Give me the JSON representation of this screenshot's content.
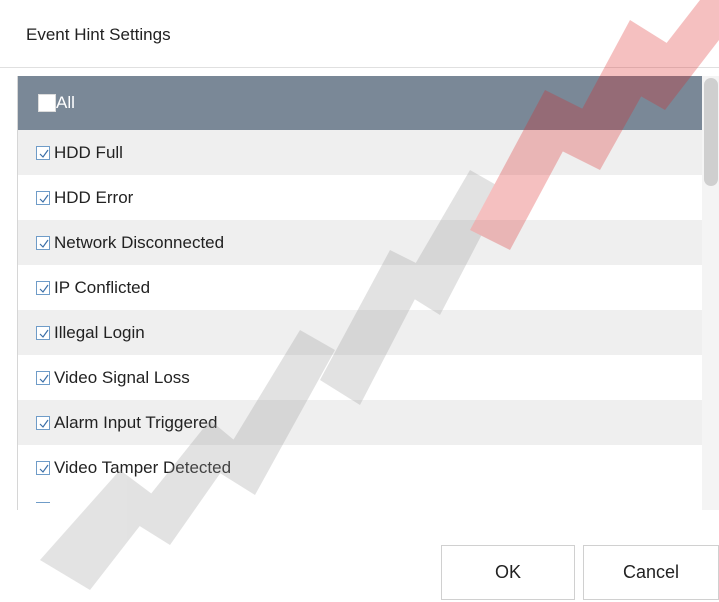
{
  "dialog": {
    "title": "Event Hint Settings"
  },
  "list": {
    "all_label": "All",
    "all_checked": false,
    "items": [
      {
        "label": "HDD Full",
        "checked": true
      },
      {
        "label": "HDD Error",
        "checked": true
      },
      {
        "label": "Network Disconnected",
        "checked": true
      },
      {
        "label": "IP Conflicted",
        "checked": true
      },
      {
        "label": "Illegal Login",
        "checked": true
      },
      {
        "label": "Video Signal Loss",
        "checked": true
      },
      {
        "label": "Alarm Input Triggered",
        "checked": true
      },
      {
        "label": "Video Tamper Detected",
        "checked": true
      }
    ]
  },
  "buttons": {
    "ok_label": "OK",
    "cancel_label": "Cancel"
  },
  "colors": {
    "header_bg": "#7a8897",
    "checkbox_border": "#6f9cc8",
    "alt_row_bg": "#efefef",
    "watermark_gray": "#b4b4b4",
    "watermark_red": "#e63a3a"
  }
}
